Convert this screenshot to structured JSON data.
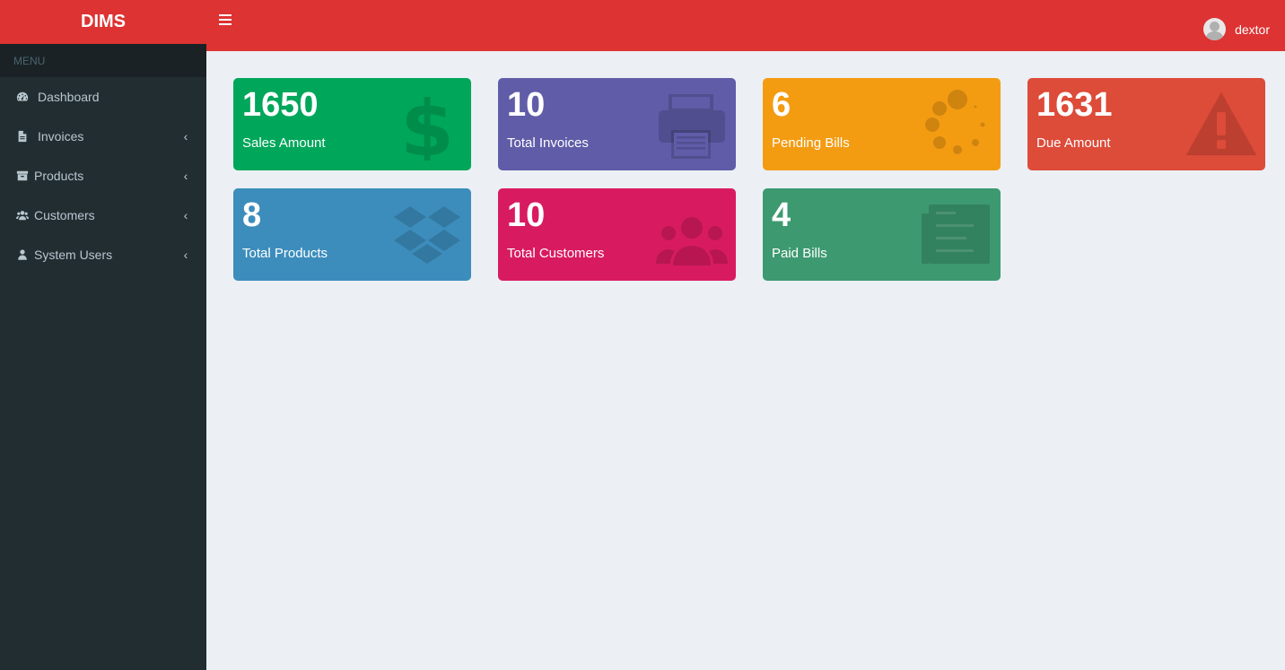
{
  "app": {
    "brand": "DIMS"
  },
  "sidebar": {
    "header": "MENU",
    "items": [
      {
        "label": "Dashboard",
        "icon": "dashboard-icon",
        "has_children": false
      },
      {
        "label": "Invoices",
        "icon": "file-icon",
        "has_children": true
      },
      {
        "label": "Products",
        "icon": "archive-icon",
        "has_children": true
      },
      {
        "label": "Customers",
        "icon": "users-icon",
        "has_children": true
      },
      {
        "label": "System Users",
        "icon": "user-icon",
        "has_children": true
      }
    ]
  },
  "topbar": {
    "user_name": "dextor"
  },
  "stats": [
    {
      "value": "1650",
      "label": "Sales Amount",
      "color": "#00a65a",
      "icon": "dollar-icon"
    },
    {
      "value": "10",
      "label": "Total Invoices",
      "color": "#605ca8",
      "icon": "print-icon"
    },
    {
      "value": "6",
      "label": "Pending Bills",
      "color": "#f39c12",
      "icon": "spinner-icon"
    },
    {
      "value": "1631",
      "label": "Due Amount",
      "color": "#dd4b39",
      "icon": "warning-icon"
    },
    {
      "value": "8",
      "label": "Total Products",
      "color": "#3c8dbc",
      "icon": "dropbox-icon"
    },
    {
      "value": "10",
      "label": "Total Customers",
      "color": "#d81b60",
      "icon": "users-icon"
    },
    {
      "value": "4",
      "label": "Paid Bills",
      "color": "#3d9970",
      "icon": "newspaper-icon"
    }
  ]
}
